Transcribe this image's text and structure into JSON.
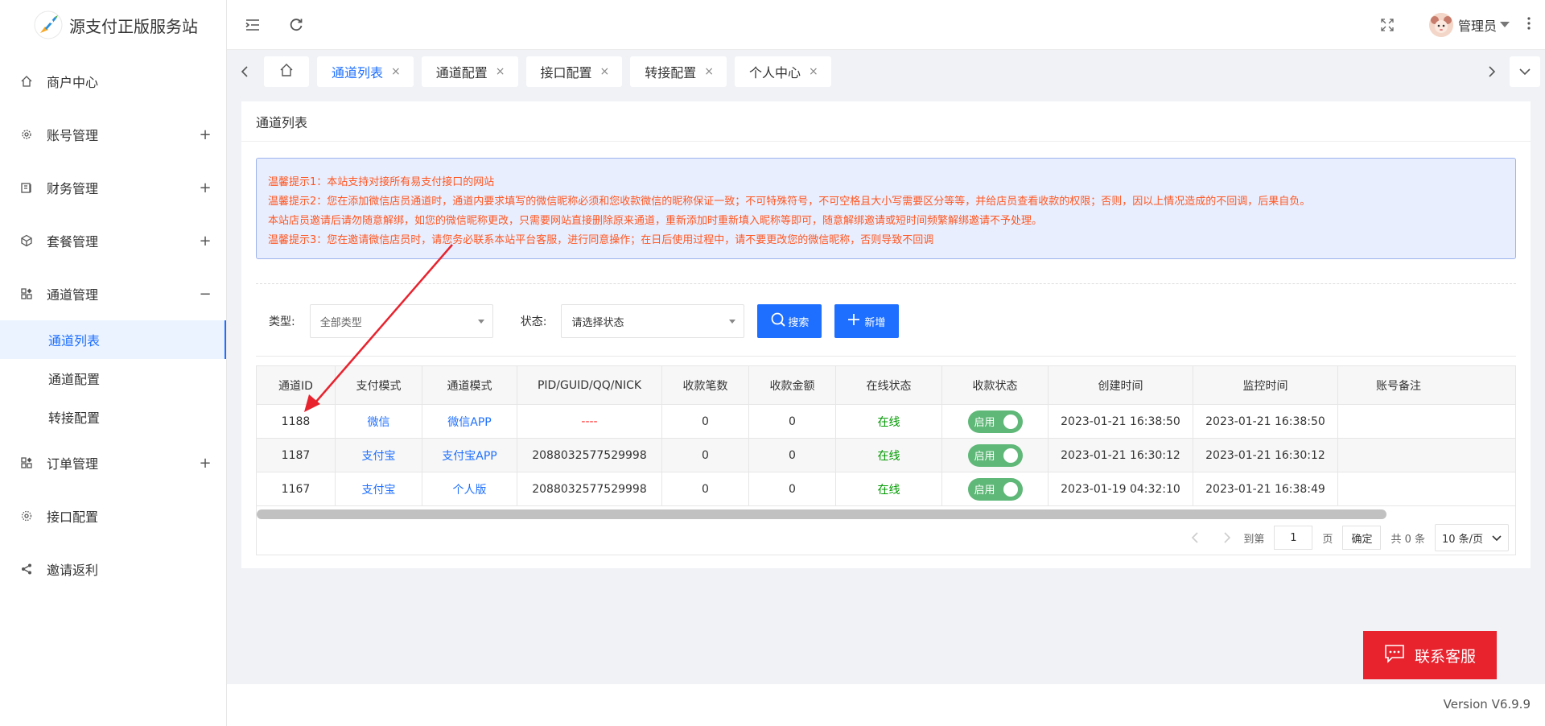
{
  "app": {
    "title": "源支付正版服务站"
  },
  "topbar": {
    "user_name": "管理员"
  },
  "sidebar": {
    "items": [
      {
        "label": "商户中心",
        "toggle": ""
      },
      {
        "label": "账号管理",
        "toggle": "+"
      },
      {
        "label": "财务管理",
        "toggle": "+"
      },
      {
        "label": "套餐管理",
        "toggle": "+"
      },
      {
        "label": "通道管理",
        "toggle": "−"
      },
      {
        "label": "订单管理",
        "toggle": "+"
      },
      {
        "label": "接口配置",
        "toggle": ""
      },
      {
        "label": "邀请返利",
        "toggle": ""
      }
    ],
    "submenu": [
      {
        "label": "通道列表"
      },
      {
        "label": "通道配置"
      },
      {
        "label": "转接配置"
      }
    ]
  },
  "tabs": [
    {
      "label": "通道列表",
      "close": "×"
    },
    {
      "label": "通道配置",
      "close": "×"
    },
    {
      "label": "接口配置",
      "close": "×"
    },
    {
      "label": "转接配置",
      "close": "×"
    },
    {
      "label": "个人中心",
      "close": "×"
    }
  ],
  "card": {
    "title": "通道列表"
  },
  "notice": [
    "温馨提示1：本站支持对接所有易支付接口的网站",
    "温馨提示2：您在添加微信店员通道时，通道内要求填写的微信昵称必须和您收款微信的昵称保证一致；不可特殊符号，不可空格且大小写需要区分等等，并给店员查看收款的权限；否则，因以上情况造成的不回调，后果自负。",
    "本站店员邀请后请勿随意解绑，如您的微信昵称更改，只需要网站直接删除原来通道，重新添加时重新填入昵称等即可，随意解绑邀请或短时间频繁解绑邀请不予处理。",
    "温馨提示3：您在邀请微信店员时，请您务必联系本站平台客服，进行同意操作；在日后使用过程中，请不要更改您的微信昵称，否则导致不回调"
  ],
  "filter": {
    "type_label": "类型:",
    "type_value": "全部类型",
    "status_label": "状态:",
    "status_placeholder": "请选择状态",
    "search_label": "搜索",
    "add_label": "新增"
  },
  "table": {
    "columns": [
      "通道ID",
      "支付模式",
      "通道模式",
      "PID/GUID/QQ/NICK",
      "收款笔数",
      "收款金额",
      "在线状态",
      "收款状态",
      "创建时间",
      "监控时间",
      "账号备注"
    ],
    "rows": [
      {
        "id": "1188",
        "pay_mode": "微信",
        "channel_mode": "微信APP",
        "pid": "----",
        "count": "0",
        "amount": "0",
        "online": "在线",
        "collect": "启用",
        "created": "2023-01-21 16:38:50",
        "monitored": "2023-01-21 16:38:50",
        "remark": ""
      },
      {
        "id": "1187",
        "pay_mode": "支付宝",
        "channel_mode": "支付宝APP",
        "pid": "2088032577529998",
        "count": "0",
        "amount": "0",
        "online": "在线",
        "collect": "启用",
        "created": "2023-01-21 16:30:12",
        "monitored": "2023-01-21 16:30:12",
        "remark": ""
      },
      {
        "id": "1167",
        "pay_mode": "支付宝",
        "channel_mode": "个人版",
        "pid": "2088032577529998",
        "count": "0",
        "amount": "0",
        "online": "在线",
        "collect": "启用",
        "created": "2023-01-19 04:32:10",
        "monitored": "2023-01-21 16:38:49",
        "remark": ""
      }
    ]
  },
  "pagination": {
    "goto_label": "到第",
    "page_value": "1",
    "page_suffix": "页",
    "confirm_label": "确定",
    "total_label": "共 0 条",
    "page_size": "10 条/页"
  },
  "contact": {
    "label": "联系客服"
  },
  "footer": {
    "version": "Version V6.9.9"
  },
  "colors": {
    "accent": "#1e6fff",
    "notice_text": "#ff5722",
    "switch_on": "#5fb878",
    "contact_bg": "#e8232e",
    "annotation_arrow": "#e8232e"
  }
}
